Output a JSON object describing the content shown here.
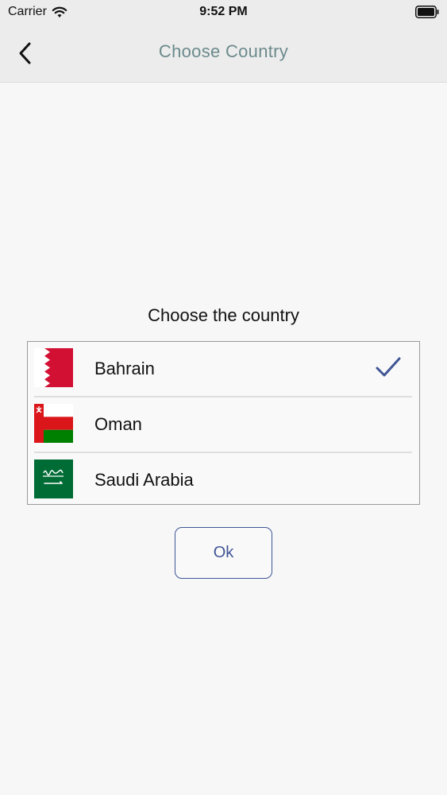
{
  "status_bar": {
    "carrier": "Carrier",
    "time": "9:52 PM",
    "icons": [
      "wifi-icon",
      "battery-icon"
    ]
  },
  "nav": {
    "back_icon": "chevron-left-icon",
    "title": "Choose Country"
  },
  "main": {
    "heading": "Choose the country",
    "countries": [
      {
        "name": "Bahrain",
        "flag": "bahrain-flag-icon",
        "selected": true
      },
      {
        "name": "Oman",
        "flag": "oman-flag-icon",
        "selected": false
      },
      {
        "name": "Saudi Arabia",
        "flag": "saudi-arabia-flag-icon",
        "selected": false
      }
    ],
    "ok_label": "Ok"
  },
  "colors": {
    "nav_title": "#6c8a8c",
    "accent": "#3f5595",
    "bahrain_red": "#d21034",
    "oman_red": "#db161b",
    "oman_green": "#008000",
    "saudi_green": "#006c35"
  }
}
